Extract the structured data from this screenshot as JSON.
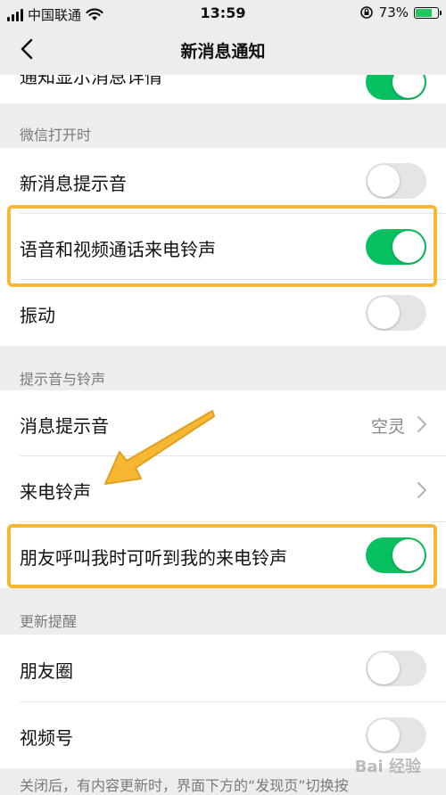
{
  "status_bar": {
    "carrier": "中国联通",
    "time": "13:59",
    "battery_percent": "73%",
    "battery_level": 0.73
  },
  "nav": {
    "title": "新消息通知",
    "back_icon": "chevron-left-icon"
  },
  "top_partial_row": {
    "label": "通知显示消息详情",
    "toggle_on": true
  },
  "sections": [
    {
      "header": "微信打开时",
      "rows": [
        {
          "label": "新消息提示音",
          "toggle_on": false
        },
        {
          "label": "语音和视频通话来电铃声",
          "toggle_on": true,
          "highlighted": true
        },
        {
          "label": "振动",
          "toggle_on": false
        }
      ]
    },
    {
      "header": "提示音与铃声",
      "rows": [
        {
          "label": "消息提示音",
          "value": "空灵"
        },
        {
          "label": "来电铃声",
          "value": ""
        },
        {
          "label": "朋友呼叫我时可听到我的来电铃声",
          "toggle_on": true,
          "highlighted": true
        }
      ]
    },
    {
      "header": "更新提醒",
      "rows": [
        {
          "label": "朋友圈",
          "toggle_on": false
        },
        {
          "label": "视频号",
          "toggle_on": false
        }
      ]
    }
  ],
  "footer_note": "关闭后，有内容更新时，界面下方的“发现页”切换按",
  "watermark": "Bai 经验",
  "colors": {
    "accent": "#07c160",
    "highlight": "#f7b733",
    "arrow": "#f7b733"
  }
}
